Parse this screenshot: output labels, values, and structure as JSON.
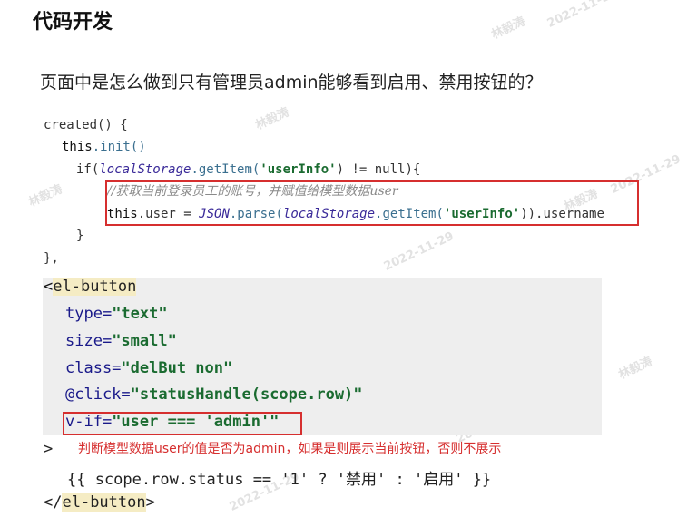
{
  "title": "代码开发",
  "question": "页面中是怎么做到只有管理员admin能够看到启用、禁用按钮的？",
  "code1": {
    "l1": "created() {",
    "l2_this": "this",
    "l2_rest": ".init()",
    "l3_if": "if(",
    "l3_ls": "localStorage",
    "l3_get": ".getItem(",
    "l3_str": "'userInfo'",
    "l3_rest": ") != null){",
    "l4_comment": "//获取当前登录员工的账号，并赋值给模型数据user",
    "l5_this": "this",
    "l5_user": ".user = ",
    "l5_json": "JSON",
    "l5_parse": ".parse(",
    "l5_ls": "localStorage",
    "l5_get": ".getItem(",
    "l5_str": "'userInfo'",
    "l5_rest": ")).username",
    "l6": "}",
    "l7": "},"
  },
  "code2": {
    "open_lt": "<",
    "open_tag": "el-button",
    "type_attr": "type=",
    "type_val": "\"text\"",
    "size_attr": "size=",
    "size_val": "\"small\"",
    "class_attr": "class=",
    "class_val": "\"delBut non\"",
    "click_attr": "@click=",
    "click_val": "\"statusHandle(scope.row)\"",
    "vif_attr": "v-if=",
    "vif_val": "\"user === 'admin'\"",
    "gt": ">",
    "body": "{{ scope.row.status == '1' ? '禁用' : '启用' }}",
    "close_lt": "</",
    "close_tag": "el-button",
    "close_gt": ">"
  },
  "note": "判断模型数据user的值是否为admin，如果是则展示当前按钮，否则不展示",
  "watermarks": {
    "name": "林毅涛",
    "date": "2022-11-29"
  }
}
